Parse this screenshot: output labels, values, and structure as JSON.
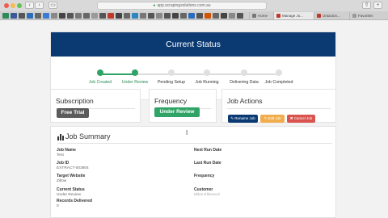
{
  "browser": {
    "url": "app.scrapingsolutions.com.au",
    "nav": {
      "back": "‹",
      "forward": "›",
      "sidebar": "▭",
      "share": "⇪",
      "newtab": "+"
    },
    "tabs": [
      {
        "label": "Home"
      },
      {
        "label": "Manage Jo..."
      },
      {
        "label": "Untacton..."
      },
      {
        "label": "Favorites"
      }
    ]
  },
  "status": {
    "title": "Current Status",
    "steps": [
      {
        "label": "Job Created",
        "done": true
      },
      {
        "label": "Under Review",
        "done": true
      },
      {
        "label": "Pending Setup",
        "done": false
      },
      {
        "label": "Job Running",
        "done": false
      },
      {
        "label": "Delivering Data",
        "done": false
      },
      {
        "label": "Job Completed",
        "done": false
      }
    ]
  },
  "subscription": {
    "title": "Subscription",
    "value": "Free Trial"
  },
  "frequency": {
    "title": "Frequency",
    "value": "Under Review"
  },
  "job_actions": {
    "title": "Job Actions",
    "rename": "Rename Job",
    "edit": "Edit Job",
    "cancel": "Cancel Job"
  },
  "summary": {
    "title": "Job Summary",
    "left": [
      {
        "label": "Job Name",
        "value": "Test"
      },
      {
        "label": "Job ID",
        "value": "EXTRACT-003804"
      },
      {
        "label": "Target Website",
        "value": "Zillow"
      },
      {
        "label": "Current Status",
        "value": "Under Review"
      },
      {
        "label": "Records Delivered",
        "value": "0"
      }
    ],
    "right": [
      {
        "label": "Next Run Date",
        "value": ""
      },
      {
        "label": "Last Run Date",
        "value": ""
      },
      {
        "label": "Frequency",
        "value": ""
      },
      {
        "label": "Customer",
        "value": "Miles Ellswood"
      }
    ]
  },
  "colors": {
    "header": "#0b3a73",
    "done": "#2fa466",
    "free_trial": "#5b5b5b",
    "rename": "#0b3a73",
    "edit": "#f0ad4e",
    "cancel": "#d9534f"
  }
}
